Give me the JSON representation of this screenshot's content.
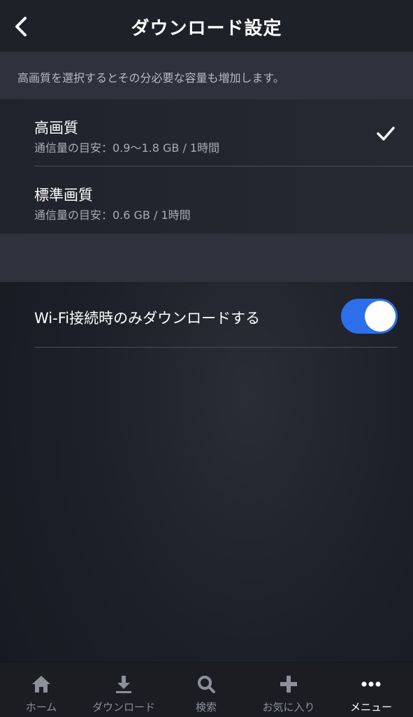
{
  "header": {
    "title": "ダウンロード設定",
    "back_icon": "chevron-left-icon"
  },
  "description": "高画質を選択するとその分必要な容量も増加します。",
  "quality_options": [
    {
      "label": "高画質",
      "sub": "通信量の目安：0.9〜1.8 GB / 1時間",
      "selected": true
    },
    {
      "label": "標準画質",
      "sub": "通信量の目安：0.6 GB / 1時間",
      "selected": false
    }
  ],
  "wifi_only": {
    "label": "Wi-Fi接続時のみダウンロードする",
    "enabled": true
  },
  "tabs": [
    {
      "label": "ホーム",
      "icon": "home-icon"
    },
    {
      "label": "ダウンロード",
      "icon": "download-icon"
    },
    {
      "label": "検索",
      "icon": "search-icon"
    },
    {
      "label": "お気に入り",
      "icon": "plus-icon"
    },
    {
      "label": "メニュー",
      "icon": "more-dots-icon",
      "active": true
    }
  ],
  "colors": {
    "accent": "#2d6fea",
    "background": "#1d2029",
    "band": "#2f323c"
  }
}
